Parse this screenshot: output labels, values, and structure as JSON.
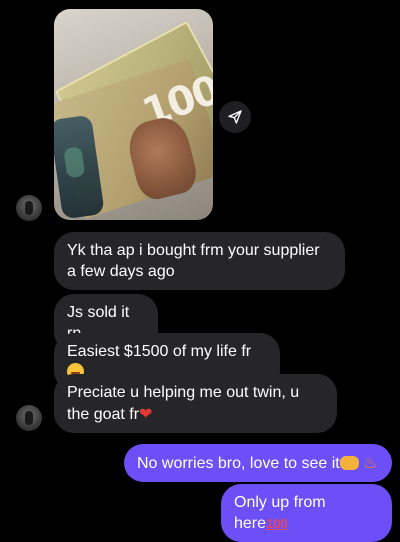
{
  "attachment": {
    "image_description_icon": "money-photo",
    "share_icon": "send-icon"
  },
  "messages": [
    {
      "direction": "incoming",
      "text": "Yk tha ap i bought frm your supplier a few days ago"
    },
    {
      "direction": "incoming",
      "text": "Js sold it rn"
    },
    {
      "direction": "incoming",
      "text": "Easiest $1500 of my life fr",
      "emoji": "rolling-laughing-emoji"
    },
    {
      "direction": "incoming",
      "text": "Preciate u helping me out twin, u the goat fr",
      "emoji": "red-heart-emoji"
    },
    {
      "direction": "outgoing",
      "text": "No worries bro, love to see it",
      "emojis": [
        "handshake-emoji",
        "fire-emoji"
      ]
    },
    {
      "direction": "outgoing",
      "text": "Only up from here",
      "emoji": "hundred-points-emoji"
    }
  ],
  "photo_text": {
    "denomination": "100"
  },
  "colors": {
    "background": "#000000",
    "incoming_bubble": "#262628",
    "outgoing_bubble": "#6c4ff6",
    "text": "#ffffff"
  }
}
